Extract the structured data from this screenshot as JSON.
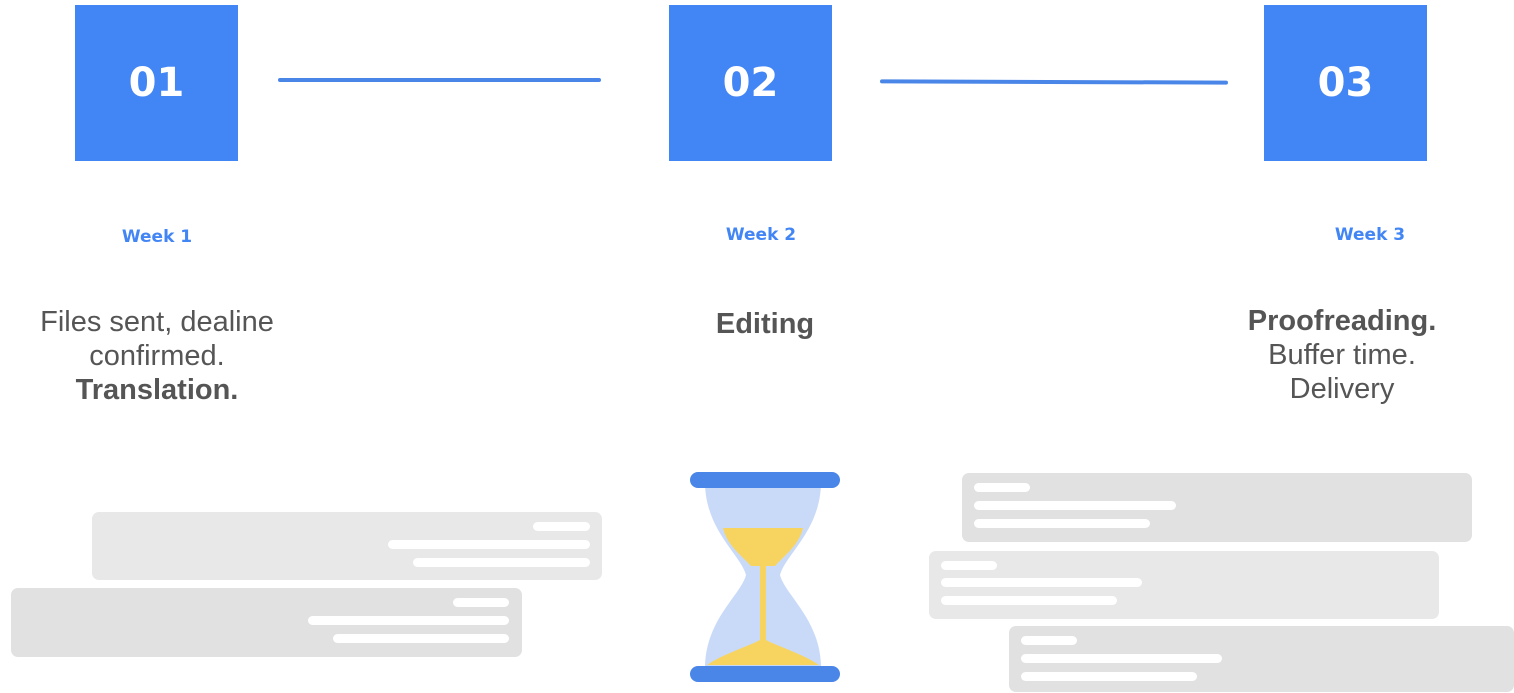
{
  "steps": [
    {
      "number": "01",
      "week": "Week 1",
      "desc_lines": [
        "Files sent, dealine",
        "confirmed."
      ],
      "desc_bold": "Translation."
    },
    {
      "number": "02",
      "week": "Week 2",
      "desc_bold": "Editing"
    },
    {
      "number": "03",
      "week": "Week 3",
      "desc_bold": "Proofreading.",
      "desc_lines": [
        "Buffer time.",
        "Delivery"
      ]
    }
  ],
  "colors": {
    "accent": "#4285f4",
    "sand": "#f7d460",
    "glass": "#c9daf8",
    "card": "#e8e8e8",
    "text": "#555555"
  },
  "icons": {
    "timer": "hourglass-icon"
  }
}
